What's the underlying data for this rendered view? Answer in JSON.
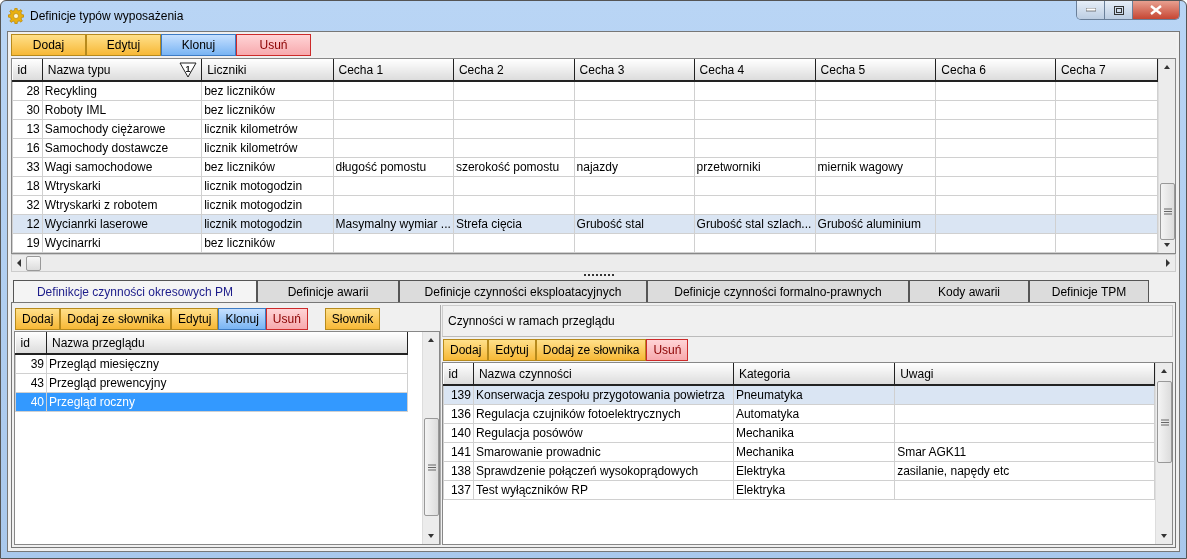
{
  "window": {
    "title": "Definicje typów wyposażenia"
  },
  "toolbar": [
    {
      "label": "Dodaj",
      "kind": "normal"
    },
    {
      "label": "Edytuj",
      "kind": "normal"
    },
    {
      "label": "Klonuj",
      "kind": "clone"
    },
    {
      "label": "Usuń",
      "kind": "delete"
    }
  ],
  "types_table": {
    "columns": [
      "id",
      "Nazwa typu",
      "Liczniki",
      "Cecha 1",
      "Cecha 2",
      "Cecha 3",
      "Cecha 4",
      "Cecha 5",
      "Cecha 6",
      "Cecha 7"
    ],
    "filter_badge": "1",
    "rows": [
      {
        "id": "28",
        "name": "Recykling",
        "counter": "bez liczników",
        "selected": false
      },
      {
        "id": "30",
        "name": "Roboty IML",
        "counter": "bez liczników",
        "selected": false
      },
      {
        "id": "13",
        "name": "Samochody ciężarowe",
        "counter": "licznik kilometrów",
        "selected": false
      },
      {
        "id": "16",
        "name": "Samochody dostawcze",
        "counter": "licznik kilometrów",
        "selected": false
      },
      {
        "id": "33",
        "name": "Wagi samochodowe",
        "counter": "bez liczników",
        "features": [
          "długość pomostu",
          "szerokość pomostu",
          "najazdy",
          "przetworniki",
          "miernik wagowy"
        ],
        "selected": false
      },
      {
        "id": "18",
        "name": "Wtryskarki",
        "counter": "licznik motogodzin",
        "selected": false
      },
      {
        "id": "32",
        "name": "Wtryskarki z robotem",
        "counter": "licznik motogodzin",
        "selected": false
      },
      {
        "id": "12",
        "name": "Wycianrki laserowe",
        "counter": "licznik motogodzin",
        "features": [
          "Masymalny wymiar ...",
          "Strefa cięcia",
          "Grubość stal",
          "Grubość stal szlach...",
          "Grubość aluminium"
        ],
        "selected": true
      },
      {
        "id": "19",
        "name": "Wycinarrki",
        "counter": "bez liczników",
        "selected": false
      }
    ]
  },
  "tabs": [
    {
      "label": "Definikcje czynności okresowych PM",
      "selected": true
    },
    {
      "label": "Definicje awarii",
      "selected": false
    },
    {
      "label": "Definicje czynności eksploatacyjnych",
      "selected": false
    },
    {
      "label": "Definicje czynności formalno-prawnych",
      "selected": false
    },
    {
      "label": "Kody awarii",
      "selected": false
    },
    {
      "label": "Definicje TPM",
      "selected": false
    }
  ],
  "reviews": {
    "toolbar": [
      {
        "label": "Dodaj",
        "kind": "normal"
      },
      {
        "label": "Dodaj ze słownika",
        "kind": "normal"
      },
      {
        "label": "Edytuj",
        "kind": "normal"
      },
      {
        "label": "Klonuj",
        "kind": "clone"
      },
      {
        "label": "Usuń",
        "kind": "delete"
      },
      {
        "label": "Słownik",
        "kind": "dictionary"
      }
    ],
    "columns": [
      "id",
      "Nazwa przeglądu"
    ],
    "rows": [
      {
        "id": "39",
        "name": "Przegląd miesięczny",
        "selected": false
      },
      {
        "id": "43",
        "name": "Przegląd prewencyjny",
        "selected": false
      },
      {
        "id": "40",
        "name": "Przegląd roczny",
        "selected": true
      }
    ]
  },
  "activities": {
    "title": "Czynności w ramach przeglądu",
    "toolbar": [
      {
        "label": "Dodaj",
        "kind": "normal"
      },
      {
        "label": "Edytuj",
        "kind": "normal"
      },
      {
        "label": "Dodaj ze słownika",
        "kind": "normal"
      },
      {
        "label": "Usuń",
        "kind": "delete"
      }
    ],
    "columns": [
      "id",
      "Nazwa czynności",
      "Kategoria",
      "Uwagi"
    ],
    "rows": [
      {
        "id": "139",
        "name": "Konserwacja zespołu przygotowania powietrza",
        "category": "Pneumatyka",
        "selected": true
      },
      {
        "id": "136",
        "name": "Regulacja czujników fotoelektrycznych",
        "category": "Automatyka",
        "selected": false
      },
      {
        "id": "140",
        "name": "Regulacja posówów",
        "category": "Mechanika",
        "selected": false
      },
      {
        "id": "141",
        "name": "Smarowanie prowadnic",
        "category": "Mechanika",
        "notes": "Smar AGK11",
        "selected": false
      },
      {
        "id": "138",
        "name": "Sprawdzenie połączeń wysokoprądowych",
        "category": "Elektryka",
        "notes": "zasilanie, napędy etc",
        "selected": false
      },
      {
        "id": "137",
        "name": "Test wyłączników RP",
        "category": "Elektryka",
        "selected": false
      }
    ]
  }
}
